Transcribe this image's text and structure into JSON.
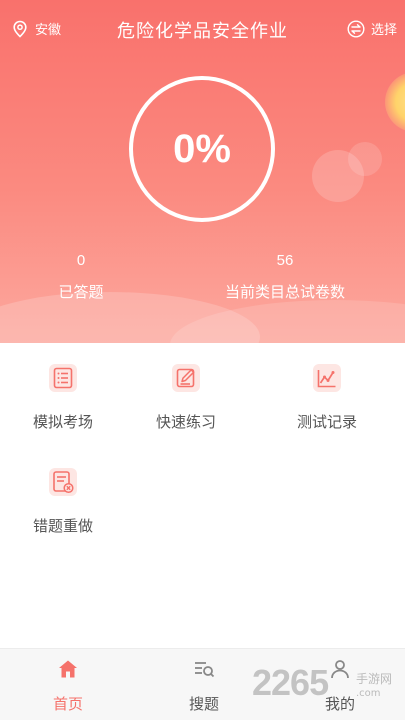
{
  "header": {
    "location": "安徽",
    "title": "危险化学品安全作业",
    "select_label": "选择"
  },
  "progress": {
    "percent_text": "0%",
    "percent": 0
  },
  "stats": [
    {
      "value": "0",
      "label": "已答题"
    },
    {
      "value": "56",
      "label": "当前类目总试卷数"
    }
  ],
  "menu": [
    {
      "label": "模拟考场",
      "icon": "list-document-icon"
    },
    {
      "label": "快速练习",
      "icon": "edit-pencil-icon"
    },
    {
      "label": "测试记录",
      "icon": "line-chart-icon"
    },
    {
      "label": "错题重做",
      "icon": "error-document-icon"
    }
  ],
  "tabs": [
    {
      "label": "首页",
      "icon": "home-icon",
      "active": true
    },
    {
      "label": "搜题",
      "icon": "search-list-icon",
      "active": false
    },
    {
      "label": "我的",
      "icon": "user-icon",
      "active": false
    }
  ],
  "watermark": {
    "number": "2265",
    "text": "手游网",
    "domain": ".com"
  },
  "colors": {
    "accent": "#f5726b",
    "hero_top": "#f9716c",
    "hero_bottom": "#fca89e",
    "icon_bg": "#fde6e3"
  }
}
